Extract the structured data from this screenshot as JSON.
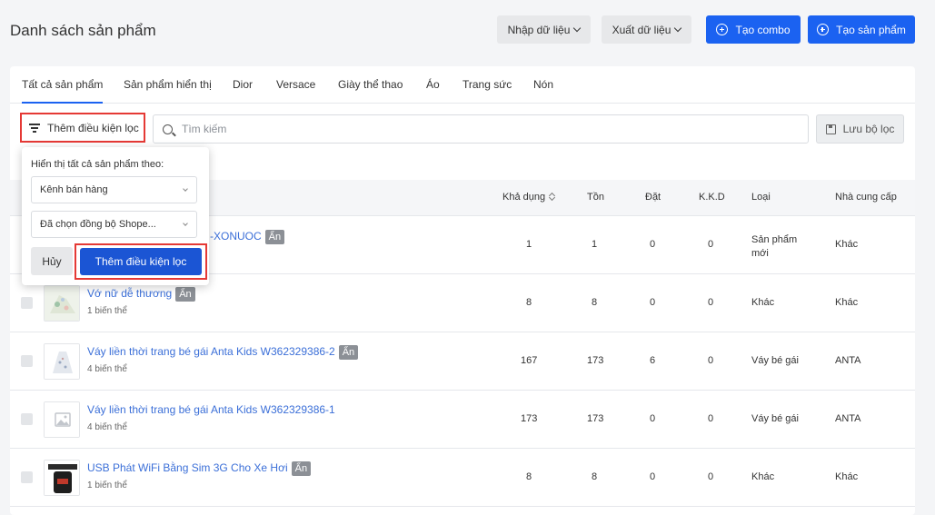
{
  "header": {
    "title": "Danh sách sản phẩm",
    "import_label": "Nhập dữ liệu",
    "export_label": "Xuất dữ liệu",
    "create_combo_label": "Tạo combo",
    "create_product_label": "Tạo sản phẩm"
  },
  "tabs": [
    {
      "label": "Tất cả sản phẩm",
      "active": true
    },
    {
      "label": "Sản phẩm hiển thị"
    },
    {
      "label": "Dior"
    },
    {
      "label": "Versace"
    },
    {
      "label": "Giày thể thao"
    },
    {
      "label": "Áo"
    },
    {
      "label": "Trang sức"
    },
    {
      "label": "Nón"
    }
  ],
  "toolbar": {
    "filter_label": "Thêm điều kiện lọc",
    "search_placeholder": "Tìm kiếm",
    "save_filter_label": "Lưu bộ lọc"
  },
  "table": {
    "columns": [
      "Khả dụng",
      "Tồn",
      "Đặt",
      "K.K.D",
      "Loại",
      "Nhà cung cấp"
    ],
    "rows": [
      {
        "name": "-XONUOC",
        "badge": "Ẩn",
        "variants": "",
        "available": "1",
        "stock": "1",
        "ordered": "0",
        "kkd": "0",
        "type": "Sản phẩm mới",
        "supplier": "Khác"
      },
      {
        "name": "Vớ nữ dễ thương",
        "badge": "Ẩn",
        "variants": "1 biến thể",
        "available": "8",
        "stock": "8",
        "ordered": "0",
        "kkd": "0",
        "type": "Khác",
        "supplier": "Khác"
      },
      {
        "name": "Váy liền thời trang bé gái Anta Kids W362329386-2",
        "badge": "Ẩn",
        "variants": "4 biến thể",
        "available": "167",
        "stock": "173",
        "ordered": "6",
        "kkd": "0",
        "type": "Váy bé gái",
        "supplier": "ANTA"
      },
      {
        "name": "Váy liền thời trang bé gái Anta Kids W362329386-1",
        "badge": "",
        "variants": "4 biến thể",
        "available": "173",
        "stock": "173",
        "ordered": "0",
        "kkd": "0",
        "type": "Váy bé gái",
        "supplier": "ANTA"
      },
      {
        "name": "USB Phát WiFi Bằng Sim 3G Cho Xe Hơi",
        "badge": "Ẩn",
        "variants": "1 biến thể",
        "available": "8",
        "stock": "8",
        "ordered": "0",
        "kkd": "0",
        "type": "Khác",
        "supplier": "Khác"
      }
    ]
  },
  "popup": {
    "title": "Hiển thị tất cả sản phẩm theo:",
    "select1": "Kênh bán hàng",
    "select2": "Đã chọn đồng bộ Shope...",
    "cancel_label": "Hủy",
    "apply_label": "Thêm điều kiện lọc"
  },
  "colors": {
    "primary": "#1b62f1",
    "highlight": "#e53935",
    "link": "#3b6fd8"
  }
}
